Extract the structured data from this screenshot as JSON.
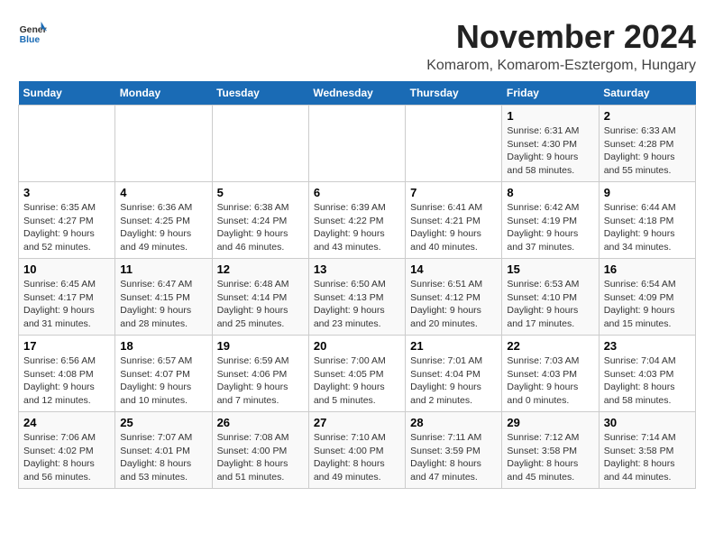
{
  "header": {
    "logo_general": "General",
    "logo_blue": "Blue",
    "title": "November 2024",
    "subtitle": "Komarom, Komarom-Esztergom, Hungary"
  },
  "days_of_week": [
    "Sunday",
    "Monday",
    "Tuesday",
    "Wednesday",
    "Thursday",
    "Friday",
    "Saturday"
  ],
  "weeks": [
    [
      {
        "day": "",
        "info": ""
      },
      {
        "day": "",
        "info": ""
      },
      {
        "day": "",
        "info": ""
      },
      {
        "day": "",
        "info": ""
      },
      {
        "day": "",
        "info": ""
      },
      {
        "day": "1",
        "info": "Sunrise: 6:31 AM\nSunset: 4:30 PM\nDaylight: 9 hours and 58 minutes."
      },
      {
        "day": "2",
        "info": "Sunrise: 6:33 AM\nSunset: 4:28 PM\nDaylight: 9 hours and 55 minutes."
      }
    ],
    [
      {
        "day": "3",
        "info": "Sunrise: 6:35 AM\nSunset: 4:27 PM\nDaylight: 9 hours and 52 minutes."
      },
      {
        "day": "4",
        "info": "Sunrise: 6:36 AM\nSunset: 4:25 PM\nDaylight: 9 hours and 49 minutes."
      },
      {
        "day": "5",
        "info": "Sunrise: 6:38 AM\nSunset: 4:24 PM\nDaylight: 9 hours and 46 minutes."
      },
      {
        "day": "6",
        "info": "Sunrise: 6:39 AM\nSunset: 4:22 PM\nDaylight: 9 hours and 43 minutes."
      },
      {
        "day": "7",
        "info": "Sunrise: 6:41 AM\nSunset: 4:21 PM\nDaylight: 9 hours and 40 minutes."
      },
      {
        "day": "8",
        "info": "Sunrise: 6:42 AM\nSunset: 4:19 PM\nDaylight: 9 hours and 37 minutes."
      },
      {
        "day": "9",
        "info": "Sunrise: 6:44 AM\nSunset: 4:18 PM\nDaylight: 9 hours and 34 minutes."
      }
    ],
    [
      {
        "day": "10",
        "info": "Sunrise: 6:45 AM\nSunset: 4:17 PM\nDaylight: 9 hours and 31 minutes."
      },
      {
        "day": "11",
        "info": "Sunrise: 6:47 AM\nSunset: 4:15 PM\nDaylight: 9 hours and 28 minutes."
      },
      {
        "day": "12",
        "info": "Sunrise: 6:48 AM\nSunset: 4:14 PM\nDaylight: 9 hours and 25 minutes."
      },
      {
        "day": "13",
        "info": "Sunrise: 6:50 AM\nSunset: 4:13 PM\nDaylight: 9 hours and 23 minutes."
      },
      {
        "day": "14",
        "info": "Sunrise: 6:51 AM\nSunset: 4:12 PM\nDaylight: 9 hours and 20 minutes."
      },
      {
        "day": "15",
        "info": "Sunrise: 6:53 AM\nSunset: 4:10 PM\nDaylight: 9 hours and 17 minutes."
      },
      {
        "day": "16",
        "info": "Sunrise: 6:54 AM\nSunset: 4:09 PM\nDaylight: 9 hours and 15 minutes."
      }
    ],
    [
      {
        "day": "17",
        "info": "Sunrise: 6:56 AM\nSunset: 4:08 PM\nDaylight: 9 hours and 12 minutes."
      },
      {
        "day": "18",
        "info": "Sunrise: 6:57 AM\nSunset: 4:07 PM\nDaylight: 9 hours and 10 minutes."
      },
      {
        "day": "19",
        "info": "Sunrise: 6:59 AM\nSunset: 4:06 PM\nDaylight: 9 hours and 7 minutes."
      },
      {
        "day": "20",
        "info": "Sunrise: 7:00 AM\nSunset: 4:05 PM\nDaylight: 9 hours and 5 minutes."
      },
      {
        "day": "21",
        "info": "Sunrise: 7:01 AM\nSunset: 4:04 PM\nDaylight: 9 hours and 2 minutes."
      },
      {
        "day": "22",
        "info": "Sunrise: 7:03 AM\nSunset: 4:03 PM\nDaylight: 9 hours and 0 minutes."
      },
      {
        "day": "23",
        "info": "Sunrise: 7:04 AM\nSunset: 4:03 PM\nDaylight: 8 hours and 58 minutes."
      }
    ],
    [
      {
        "day": "24",
        "info": "Sunrise: 7:06 AM\nSunset: 4:02 PM\nDaylight: 8 hours and 56 minutes."
      },
      {
        "day": "25",
        "info": "Sunrise: 7:07 AM\nSunset: 4:01 PM\nDaylight: 8 hours and 53 minutes."
      },
      {
        "day": "26",
        "info": "Sunrise: 7:08 AM\nSunset: 4:00 PM\nDaylight: 8 hours and 51 minutes."
      },
      {
        "day": "27",
        "info": "Sunrise: 7:10 AM\nSunset: 4:00 PM\nDaylight: 8 hours and 49 minutes."
      },
      {
        "day": "28",
        "info": "Sunrise: 7:11 AM\nSunset: 3:59 PM\nDaylight: 8 hours and 47 minutes."
      },
      {
        "day": "29",
        "info": "Sunrise: 7:12 AM\nSunset: 3:58 PM\nDaylight: 8 hours and 45 minutes."
      },
      {
        "day": "30",
        "info": "Sunrise: 7:14 AM\nSunset: 3:58 PM\nDaylight: 8 hours and 44 minutes."
      }
    ]
  ]
}
